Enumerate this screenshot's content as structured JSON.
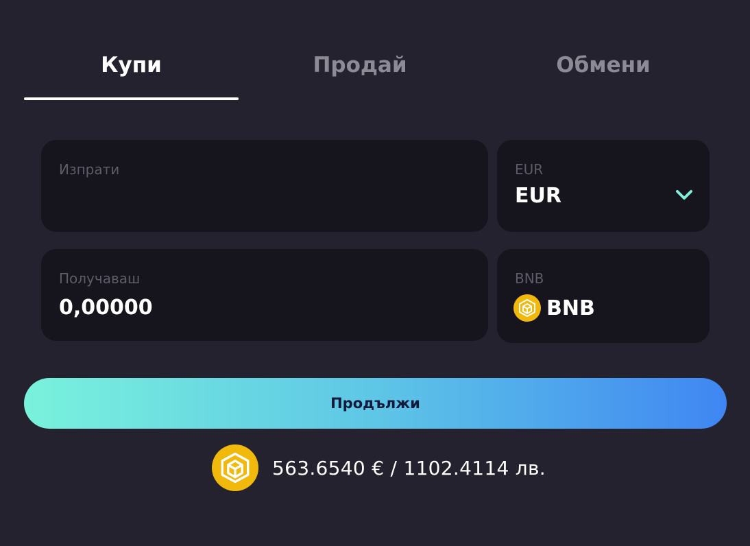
{
  "tabs": {
    "buy": "Купи",
    "sell": "Продай",
    "exchange": "Обмени",
    "active": "buy"
  },
  "send": {
    "label": "Изпрати",
    "value": "",
    "placeholder": ""
  },
  "send_currency": {
    "label": "EUR",
    "selected": "EUR",
    "icon": "chevron-down-icon",
    "accent_color": "#7ef0db"
  },
  "receive": {
    "label": "Получаваш",
    "value": "0,00000"
  },
  "receive_currency": {
    "label": "BNB",
    "selected": "BNB",
    "icon": "bnb-coin-icon",
    "coin_color": "#f0b90b"
  },
  "continue_button": {
    "label": "Продължи",
    "gradient": [
      "#79f2dc",
      "#3f86f3"
    ]
  },
  "rate": {
    "icon": "bnb-coin-icon",
    "text": "563.6540 € / 1102.4114 лв."
  }
}
